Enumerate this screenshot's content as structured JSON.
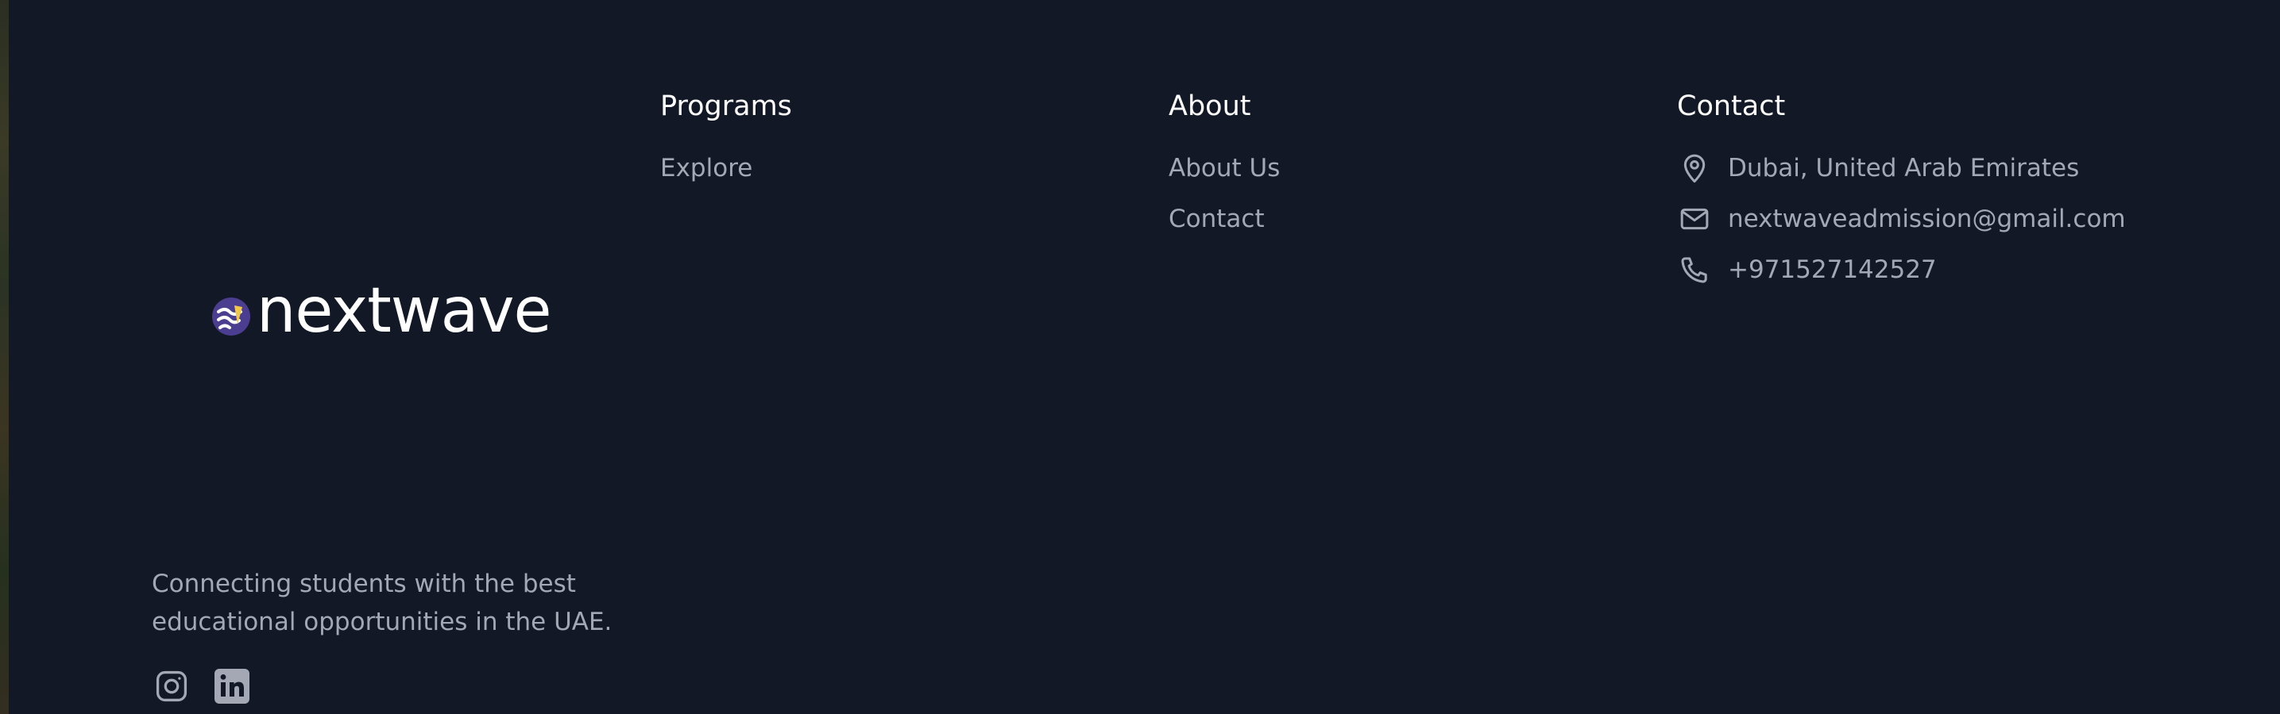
{
  "brand": {
    "name": "nextwave",
    "tagline": "Connecting students with the best educational opportunities in the UAE."
  },
  "columns": {
    "programs": {
      "title": "Programs",
      "links": [
        "Explore"
      ]
    },
    "about": {
      "title": "About",
      "links": [
        "About Us",
        "Contact"
      ]
    },
    "contact": {
      "title": "Contact",
      "items": [
        {
          "icon": "map-pin-icon",
          "text": "Dubai, United Arab Emirates"
        },
        {
          "icon": "mail-icon",
          "text": "nextwaveadmission@gmail.com"
        },
        {
          "icon": "phone-icon",
          "text": "+971527142527"
        }
      ]
    }
  },
  "socials": [
    {
      "icon": "instagram-icon"
    },
    {
      "icon": "linkedin-icon"
    }
  ],
  "colors": {
    "background": "#121826",
    "heading": "#ffffff",
    "muted_text": "#a3a8b4",
    "logo_purple": "#4b3d8f",
    "logo_yellow": "#f2c84b"
  }
}
